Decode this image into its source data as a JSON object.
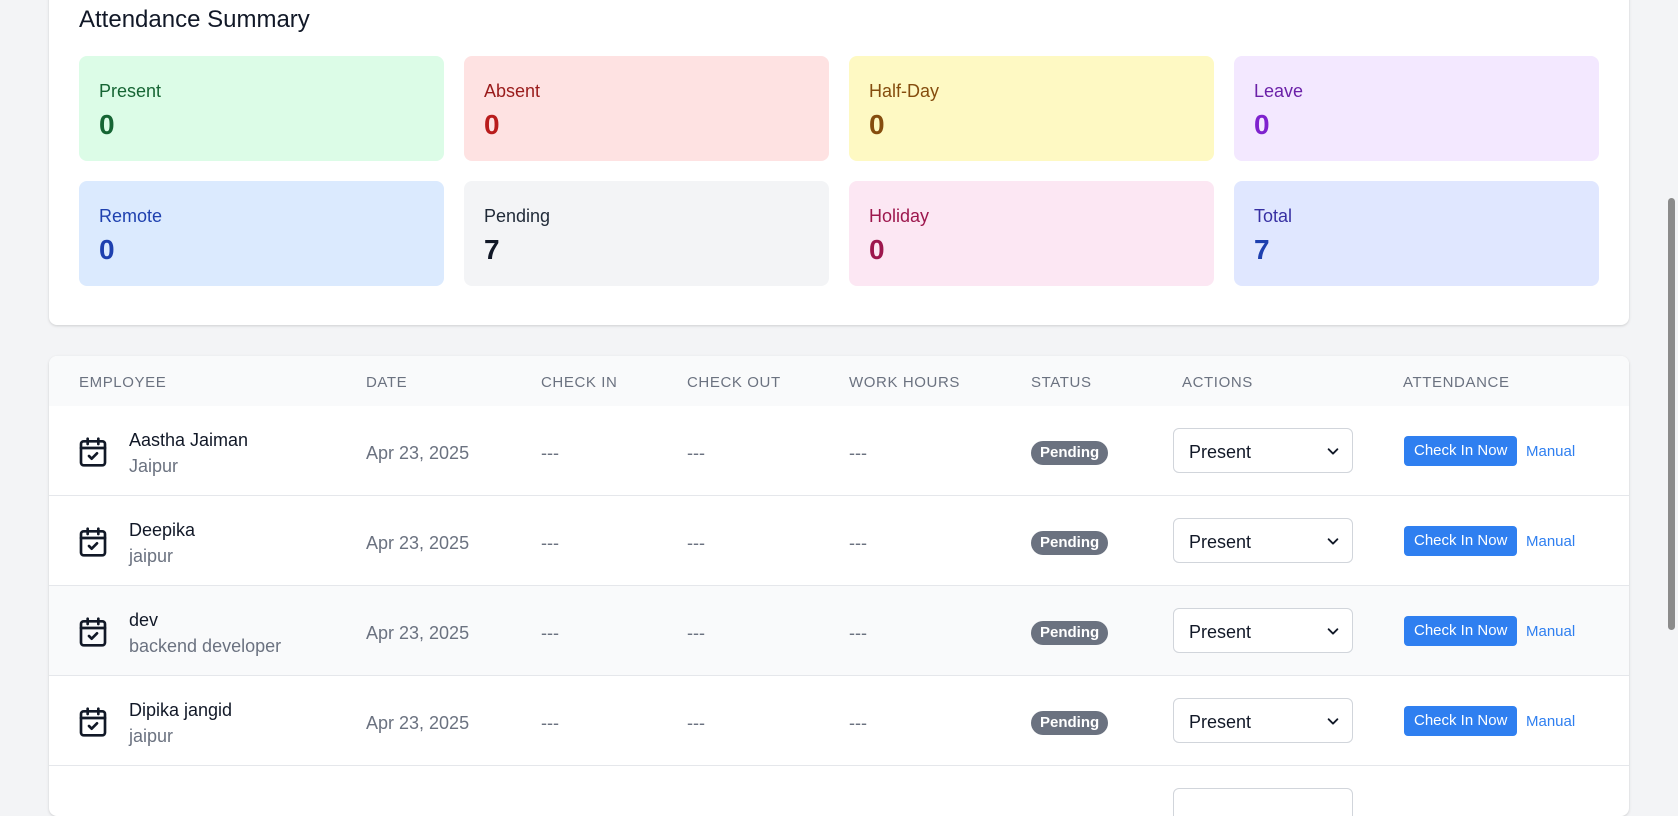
{
  "summary": {
    "title": "Attendance Summary",
    "stats": [
      {
        "label": "Present",
        "value": "0",
        "bg": "#dcfce7",
        "label_color": "#166534",
        "value_color": "#166534"
      },
      {
        "label": "Absent",
        "value": "0",
        "bg": "#fee2e2",
        "label_color": "#991b1b",
        "value_color": "#b91c1c"
      },
      {
        "label": "Half-Day",
        "value": "0",
        "bg": "#fef9c3",
        "label_color": "#854d0e",
        "value_color": "#854d0e"
      },
      {
        "label": "Leave",
        "value": "0",
        "bg": "#f3e8ff",
        "label_color": "#6b21a8",
        "value_color": "#7e22ce"
      },
      {
        "label": "Remote",
        "value": "0",
        "bg": "#dbeafe",
        "label_color": "#1e40af",
        "value_color": "#1e40af"
      },
      {
        "label": "Pending",
        "value": "7",
        "bg": "#f3f4f6",
        "label_color": "#1f2937",
        "value_color": "#111827"
      },
      {
        "label": "Holiday",
        "value": "0",
        "bg": "#fce7f3",
        "label_color": "#9d174d",
        "value_color": "#9d174d"
      },
      {
        "label": "Total",
        "value": "7",
        "bg": "#e0e7ff",
        "label_color": "#3730a3",
        "value_color": "#1e40af"
      }
    ]
  },
  "table": {
    "headers": {
      "employee": "Employee",
      "date": "Date",
      "check_in": "Check In",
      "check_out": "Check Out",
      "work_hours": "Work Hours",
      "status": "Status",
      "actions": "Actions",
      "attendance": "Attendance"
    },
    "rows": [
      {
        "name": "Aastha Jaiman",
        "location": "Jaipur",
        "date": "Apr 23, 2025",
        "check_in": "---",
        "check_out": "---",
        "work_hours": "---",
        "status": "Pending",
        "action": "Present",
        "checkin_label": "Check In Now",
        "manual_label": "Manual"
      },
      {
        "name": "Deepika",
        "location": "jaipur",
        "date": "Apr 23, 2025",
        "check_in": "---",
        "check_out": "---",
        "work_hours": "---",
        "status": "Pending",
        "action": "Present",
        "checkin_label": "Check In Now",
        "manual_label": "Manual"
      },
      {
        "name": "dev",
        "location": "backend developer",
        "date": "Apr 23, 2025",
        "check_in": "---",
        "check_out": "---",
        "work_hours": "---",
        "status": "Pending",
        "action": "Present",
        "checkin_label": "Check In Now",
        "manual_label": "Manual"
      },
      {
        "name": "Dipika jangid",
        "location": "jaipur",
        "date": "Apr 23, 2025",
        "check_in": "---",
        "check_out": "---",
        "work_hours": "---",
        "status": "Pending",
        "action": "Present",
        "checkin_label": "Check In Now",
        "manual_label": "Manual"
      }
    ]
  },
  "icons": {
    "row_icon": "calendar-check-icon",
    "select_icon": "chevron-down-icon"
  }
}
